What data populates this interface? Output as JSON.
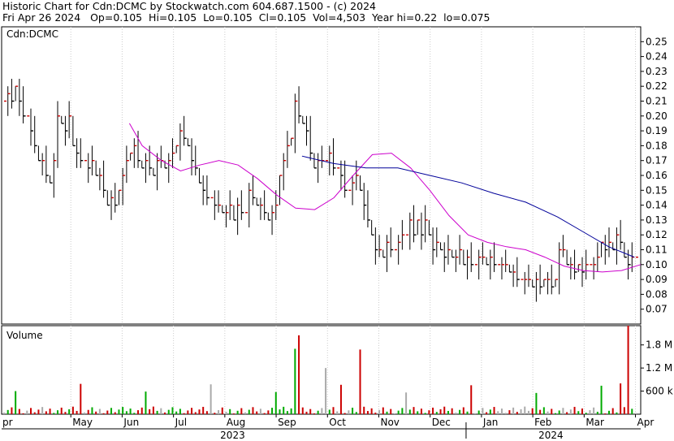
{
  "header": {
    "title_line": "Historic Chart for Cdn:DCMC by Stockwatch.com 604.687.1500 - (c) 2024",
    "quote_line": "Fri Apr 26 2024   Op=0.105  Hi=0.105  Lo=0.105  Cl=0.105  Vol=4,503  Year hi=0.22  lo=0.075"
  },
  "colors": {
    "up": "#cc0000",
    "down": "#000000",
    "ma_short": "#cc00cc",
    "ma_long": "#000099",
    "vol_green": "#00aa00",
    "vol_grey": "#aaaaaa",
    "grid": "#cccccc"
  },
  "chart_data": [
    {
      "type": "candlestick",
      "panel": "price",
      "label": "Cdn:DCMC",
      "ylim": [
        0.06,
        0.26
      ],
      "y_ticks": [
        "0.25",
        "0.24",
        "0.23",
        "0.22",
        "0.21",
        "0.20",
        "0.19",
        "0.18",
        "0.17",
        "0.16",
        "0.15",
        "0.14",
        "0.13",
        "0.12",
        "0.11",
        "0.10",
        "0.09",
        "0.08",
        "0.07"
      ],
      "months": [
        "pr",
        "May",
        "Jun",
        "Jul",
        "Aug",
        "Sep",
        "Oct",
        "Nov",
        "Dec",
        "Jan",
        "Feb",
        "Mar",
        "Apr"
      ],
      "years": [
        "2023",
        "2024"
      ],
      "closes": [
        0.21,
        0.215,
        0.21,
        0.22,
        0.21,
        0.2,
        0.2,
        0.19,
        0.18,
        0.17,
        0.17,
        0.16,
        0.155,
        0.17,
        0.2,
        0.195,
        0.19,
        0.2,
        0.18,
        0.175,
        0.17,
        0.17,
        0.165,
        0.17,
        0.16,
        0.16,
        0.15,
        0.14,
        0.145,
        0.14,
        0.15,
        0.16,
        0.17,
        0.175,
        0.18,
        0.17,
        0.165,
        0.17,
        0.165,
        0.16,
        0.17,
        0.17,
        0.165,
        0.17,
        0.175,
        0.18,
        0.19,
        0.185,
        0.18,
        0.17,
        0.165,
        0.155,
        0.15,
        0.145,
        0.145,
        0.14,
        0.14,
        0.135,
        0.135,
        0.14,
        0.13,
        0.14,
        0.135,
        0.135,
        0.15,
        0.145,
        0.14,
        0.14,
        0.135,
        0.13,
        0.135,
        0.14,
        0.16,
        0.17,
        0.18,
        0.185,
        0.21,
        0.2,
        0.195,
        0.19,
        0.175,
        0.165,
        0.17,
        0.17,
        0.17,
        0.175,
        0.165,
        0.165,
        0.16,
        0.15,
        0.15,
        0.155,
        0.16,
        0.15,
        0.14,
        0.13,
        0.12,
        0.11,
        0.11,
        0.105,
        0.115,
        0.11,
        0.11,
        0.115,
        0.12,
        0.12,
        0.13,
        0.12,
        0.13,
        0.12,
        0.13,
        0.12,
        0.11,
        0.115,
        0.11,
        0.105,
        0.11,
        0.105,
        0.105,
        0.11,
        0.1,
        0.105,
        0.1,
        0.1,
        0.105,
        0.105,
        0.1,
        0.105,
        0.1,
        0.1,
        0.1,
        0.1,
        0.095,
        0.095,
        0.09,
        0.09,
        0.09,
        0.09,
        0.085,
        0.09,
        0.085,
        0.09,
        0.09,
        0.085,
        0.09,
        0.11,
        0.11,
        0.1,
        0.1,
        0.095,
        0.1,
        0.095,
        0.1,
        0.1,
        0.1,
        0.105,
        0.115,
        0.11,
        0.115,
        0.11,
        0.12,
        0.115,
        0.105,
        0.1,
        0.105,
        0.105
      ],
      "ma_short": [
        [
          0.2,
          0.195
        ],
        [
          0.22,
          0.18
        ],
        [
          0.25,
          0.17
        ],
        [
          0.28,
          0.163
        ],
        [
          0.31,
          0.167
        ],
        [
          0.34,
          0.17
        ],
        [
          0.37,
          0.167
        ],
        [
          0.4,
          0.158
        ],
        [
          0.43,
          0.147
        ],
        [
          0.46,
          0.138
        ],
        [
          0.49,
          0.137
        ],
        [
          0.52,
          0.145
        ],
        [
          0.55,
          0.16
        ],
        [
          0.58,
          0.174
        ],
        [
          0.61,
          0.175
        ],
        [
          0.64,
          0.165
        ],
        [
          0.67,
          0.15
        ],
        [
          0.7,
          0.133
        ],
        [
          0.73,
          0.12
        ],
        [
          0.76,
          0.115
        ],
        [
          0.79,
          0.112
        ],
        [
          0.82,
          0.11
        ],
        [
          0.85,
          0.105
        ],
        [
          0.88,
          0.099
        ],
        [
          0.91,
          0.096
        ],
        [
          0.94,
          0.095
        ],
        [
          0.97,
          0.096
        ],
        [
          1.0,
          0.1
        ],
        [
          1.03,
          0.105
        ]
      ],
      "ma_long": [
        [
          0.47,
          0.173
        ],
        [
          0.52,
          0.168
        ],
        [
          0.57,
          0.165
        ],
        [
          0.62,
          0.165
        ],
        [
          0.67,
          0.16
        ],
        [
          0.72,
          0.155
        ],
        [
          0.77,
          0.148
        ],
        [
          0.82,
          0.142
        ],
        [
          0.87,
          0.132
        ],
        [
          0.91,
          0.122
        ],
        [
          0.95,
          0.112
        ],
        [
          0.99,
          0.105
        ],
        [
          1.03,
          0.105
        ]
      ]
    },
    {
      "type": "bar",
      "panel": "volume",
      "label": "Volume",
      "y_ticks": [
        "1.8 M",
        "1.2 M",
        "600 k"
      ],
      "ylim": [
        0,
        2300000
      ]
    }
  ]
}
